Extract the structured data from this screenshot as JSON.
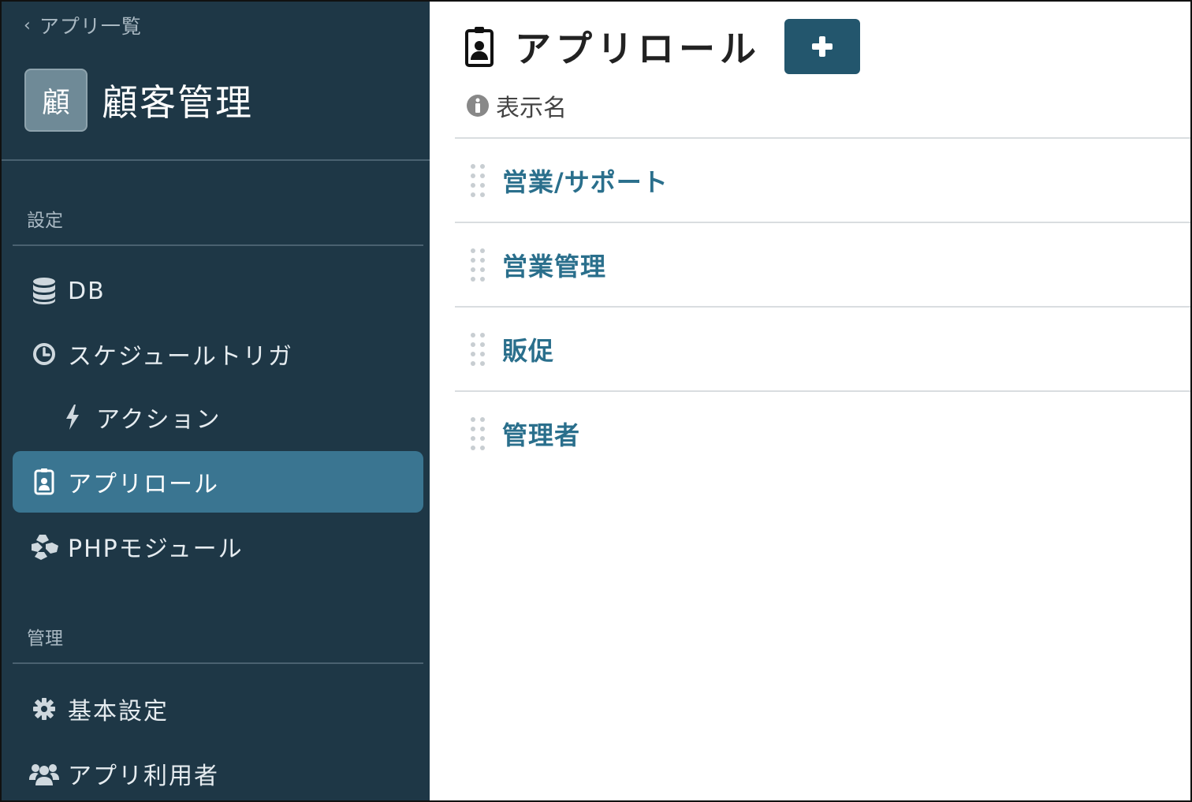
{
  "sidebar": {
    "back_label": "アプリ一覧",
    "app_avatar_char": "顧",
    "app_title": "顧客管理",
    "sections": {
      "settings_label": "設定",
      "admin_label": "管理"
    },
    "items": [
      {
        "label": "DB",
        "icon": "database-icon"
      },
      {
        "label": "スケジュールトリガ",
        "icon": "clock-icon"
      },
      {
        "label": "アクション",
        "icon": "bolt-icon"
      },
      {
        "label": "アプリロール",
        "icon": "id-badge-icon",
        "active": true
      },
      {
        "label": "PHPモジュール",
        "icon": "cubes-icon"
      },
      {
        "label": "基本設定",
        "icon": "gear-icon"
      },
      {
        "label": "アプリ利用者",
        "icon": "users-icon"
      }
    ]
  },
  "main": {
    "title": "アプリロール",
    "add_button_label": "+",
    "column_header": "表示名",
    "roles": [
      {
        "label": "営業/サポート"
      },
      {
        "label": "営業管理"
      },
      {
        "label": "販促"
      },
      {
        "label": "管理者"
      }
    ]
  },
  "colors": {
    "sidebar_bg": "#1e3746",
    "active_bg": "#3a7591",
    "accent": "#23566d",
    "link": "#2a6f8c"
  }
}
